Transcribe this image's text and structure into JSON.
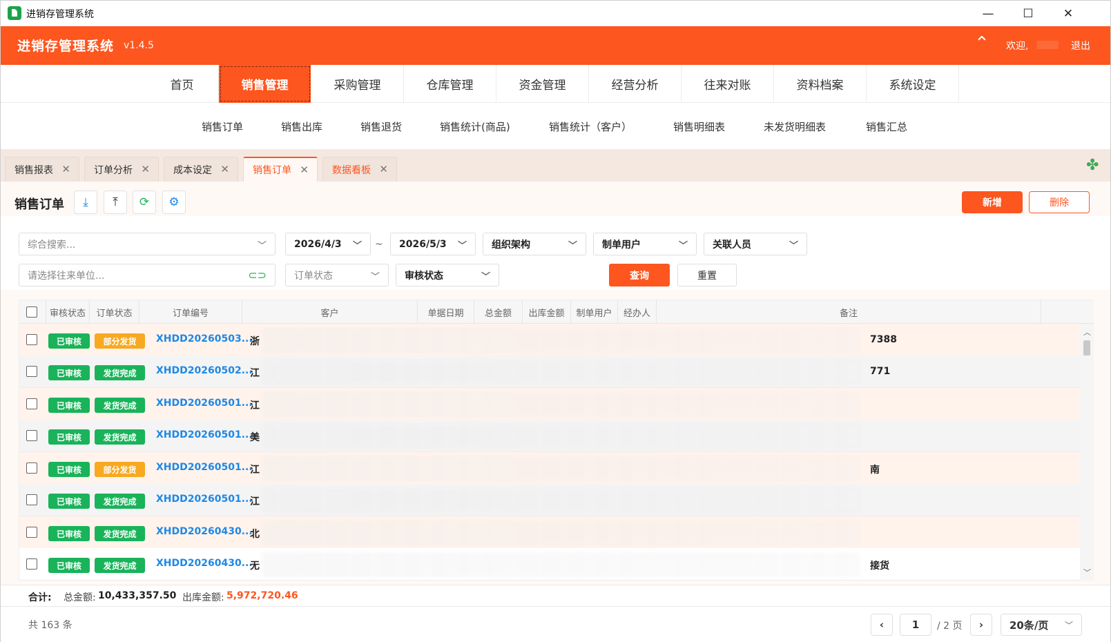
{
  "window": {
    "title": "进销存管理系统",
    "minimize": "—",
    "maximize": "☐",
    "close": "✕"
  },
  "header": {
    "brand": "进销存管理系统",
    "version": "v1.4.5",
    "welcome": "欢迎,",
    "logout": "退出",
    "collapse_icon": "⌃"
  },
  "mainnav": [
    {
      "label": "首页"
    },
    {
      "label": "销售管理",
      "active": true
    },
    {
      "label": "采购管理"
    },
    {
      "label": "仓库管理"
    },
    {
      "label": "资金管理"
    },
    {
      "label": "经营分析"
    },
    {
      "label": "往来对账"
    },
    {
      "label": "资料档案"
    },
    {
      "label": "系统设定"
    }
  ],
  "subnav": [
    {
      "label": "销售订单"
    },
    {
      "label": "销售出库"
    },
    {
      "label": "销售退货"
    },
    {
      "label": "销售统计(商品)"
    },
    {
      "label": "销售统计（客户）"
    },
    {
      "label": "销售明细表"
    },
    {
      "label": "未发货明细表"
    },
    {
      "label": "销售汇总"
    }
  ],
  "tabs": [
    {
      "label": "销售报表",
      "close": "✕"
    },
    {
      "label": "订单分析",
      "close": "✕"
    },
    {
      "label": "成本设定",
      "close": "✕"
    },
    {
      "label": "销售订单",
      "close": "✕",
      "active": true
    },
    {
      "label": "数据看板",
      "close": "✕"
    }
  ],
  "toolbar": {
    "title": "销售订单",
    "icons": [
      "download-icon",
      "upload-icon",
      "refresh-icon",
      "settings-icon"
    ],
    "add_label": "新增",
    "delete_label": "删除"
  },
  "filters": {
    "search_placeholder": "综合搜索...",
    "date_from": "2026/4/3",
    "date_sep": "~",
    "date_to": "2026/5/3",
    "org": "组织架构",
    "creator": "制单用户",
    "related": "关联人员",
    "partner_placeholder": "请选择往来单位...",
    "order_status": "订单状态",
    "audit_status": "审核状态",
    "query_label": "查询",
    "reset_label": "重置"
  },
  "table": {
    "columns": [
      "审核状态",
      "订单状态",
      "订单编号",
      "客户",
      "单据日期",
      "总金额",
      "出库金额",
      "制单用户",
      "经办人",
      "备注"
    ],
    "rows": [
      {
        "audit": "已审核",
        "status": "部分发货",
        "status_color": "orange",
        "order_no": "XHDD20260503...",
        "customer": "浙",
        "remark": "7388"
      },
      {
        "audit": "已审核",
        "status": "发货完成",
        "status_color": "green",
        "order_no": "XHDD20260502...",
        "customer": "江",
        "remark": "771"
      },
      {
        "audit": "已审核",
        "status": "发货完成",
        "status_color": "green",
        "order_no": "XHDD20260501...",
        "customer": "江",
        "remark": ""
      },
      {
        "audit": "已审核",
        "status": "发货完成",
        "status_color": "green",
        "order_no": "XHDD20260501...",
        "customer": "美",
        "remark": ""
      },
      {
        "audit": "已审核",
        "status": "部分发货",
        "status_color": "orange",
        "order_no": "XHDD20260501...",
        "customer": "江",
        "remark": "南"
      },
      {
        "audit": "已审核",
        "status": "发货完成",
        "status_color": "green",
        "order_no": "XHDD20260501...",
        "customer": "江",
        "remark": ""
      },
      {
        "audit": "已审核",
        "status": "发货完成",
        "status_color": "green",
        "order_no": "XHDD20260430...",
        "customer": "北",
        "remark": ""
      },
      {
        "audit": "已审核",
        "status": "发货完成",
        "status_color": "green",
        "order_no": "XHDD20260430...",
        "customer": "无",
        "remark": "接货"
      }
    ]
  },
  "totals": {
    "label": "合计:",
    "total_label": "总金额:",
    "total_value": "10,433,357.50",
    "out_label": "出库金额:",
    "out_value": "5,972,720.46"
  },
  "pagination": {
    "count": "共 163 条",
    "prev": "‹",
    "page": "1",
    "of_pages": "/ 2 页",
    "next": "›",
    "page_size": "20条/页"
  },
  "colors": {
    "accent": "#fd561f",
    "success": "#19b35a",
    "warning": "#f8a821",
    "link": "#1e88e5"
  }
}
